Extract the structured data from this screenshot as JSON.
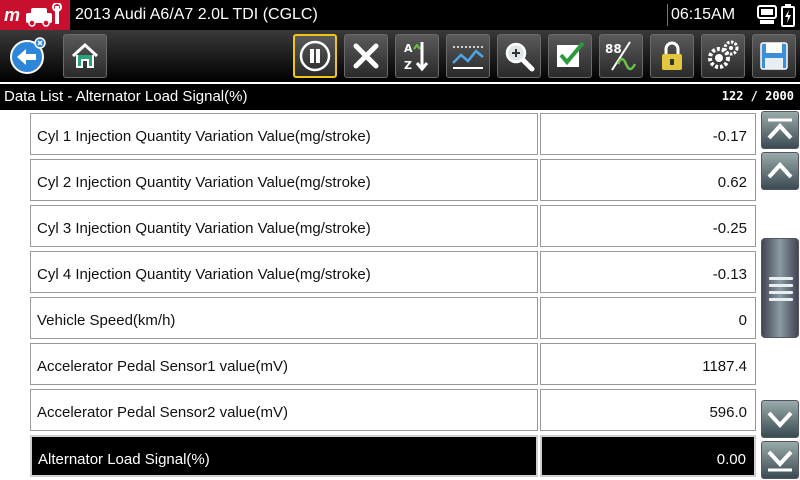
{
  "header": {
    "title": "2013 Audi A6/A7 2.0L TDI (CGLC)",
    "time": "06:15AM"
  },
  "toolbar": {
    "buttons": [
      {
        "name": "back-button",
        "icon": "back-arrow-icon"
      },
      {
        "name": "home-button",
        "icon": "home-icon"
      },
      {
        "name": "pause-button",
        "icon": "pause-icon"
      },
      {
        "name": "clear-button",
        "icon": "x-icon"
      },
      {
        "name": "sort-button",
        "icon": "sort-az-icon"
      },
      {
        "name": "graph-button",
        "icon": "graph-icon"
      },
      {
        "name": "zoom-button",
        "icon": "magnifier-icon"
      },
      {
        "name": "select-button",
        "icon": "checkmark-icon"
      },
      {
        "name": "units-button",
        "icon": "digital-analog-icon"
      },
      {
        "name": "lock-button",
        "icon": "lock-icon"
      },
      {
        "name": "settings-button",
        "icon": "gears-icon"
      },
      {
        "name": "save-button",
        "icon": "floppy-disk-icon"
      }
    ]
  },
  "subheader": {
    "title": "Data List - Alternator Load Signal(%)",
    "count": "122 / 2000"
  },
  "rows": [
    {
      "name": "Cyl 1 Injection Quantity Variation Value(mg/stroke)",
      "value": "-0.17"
    },
    {
      "name": "Cyl 2 Injection Quantity Variation Value(mg/stroke)",
      "value": "0.62"
    },
    {
      "name": "Cyl 3 Injection Quantity Variation Value(mg/stroke)",
      "value": "-0.25"
    },
    {
      "name": "Cyl 4 Injection Quantity Variation Value(mg/stroke)",
      "value": "-0.13"
    },
    {
      "name": "Vehicle Speed(km/h)",
      "value": "0"
    },
    {
      "name": "Accelerator Pedal Sensor1 value(mV)",
      "value": "1187.4"
    },
    {
      "name": "Accelerator Pedal Sensor2 value(mV)",
      "value": "596.0"
    },
    {
      "name": "Alternator Load Signal(%)",
      "value": "0.00",
      "selected": true
    }
  ],
  "colors": {
    "brand": "#c8102e",
    "pause_highlight": "#f0c419",
    "selected_row": "#000000"
  }
}
